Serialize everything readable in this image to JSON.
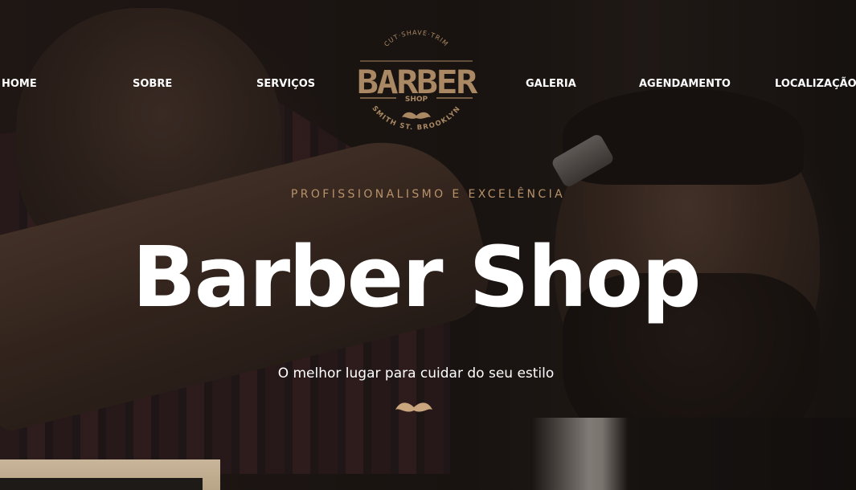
{
  "nav": {
    "items": [
      {
        "label": "HOME"
      },
      {
        "label": "SOBRE"
      },
      {
        "label": "SERVIÇOS"
      },
      {
        "label": "GALERIA"
      },
      {
        "label": "AGENDAMENTO"
      },
      {
        "label": "LOCALIZAÇÃO"
      }
    ]
  },
  "logo": {
    "top_text": "CUT·SHAVE·TRIM",
    "main": "BARBER",
    "sub": "SHOP",
    "bottom_text": "SMITH ST. BROOKLYN"
  },
  "hero": {
    "eyebrow": "PROFISSIONALISMO E EXCELÊNCIA",
    "title": "Barber Shop",
    "tagline": "O melhor lugar para cuidar do seu estilo",
    "icon": "mustache-icon"
  },
  "colors": {
    "accent": "#b8926a",
    "text": "#ffffff",
    "background": "#1a1512"
  }
}
